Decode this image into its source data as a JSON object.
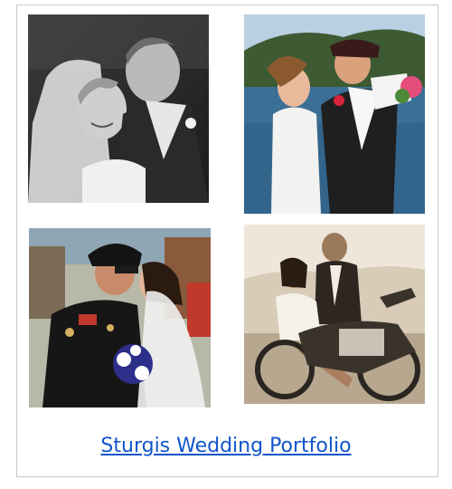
{
  "portfolio": {
    "link_label": "Sturgis Wedding Portfolio",
    "link_color": "#1155cc",
    "photos": [
      {
        "name": "photo-bw-kiss",
        "tone": "grayscale"
      },
      {
        "name": "photo-lake-embrace",
        "tone": "color"
      },
      {
        "name": "photo-biker-kiss",
        "tone": "color"
      },
      {
        "name": "photo-motorcycle-couple",
        "tone": "sepia"
      }
    ]
  }
}
